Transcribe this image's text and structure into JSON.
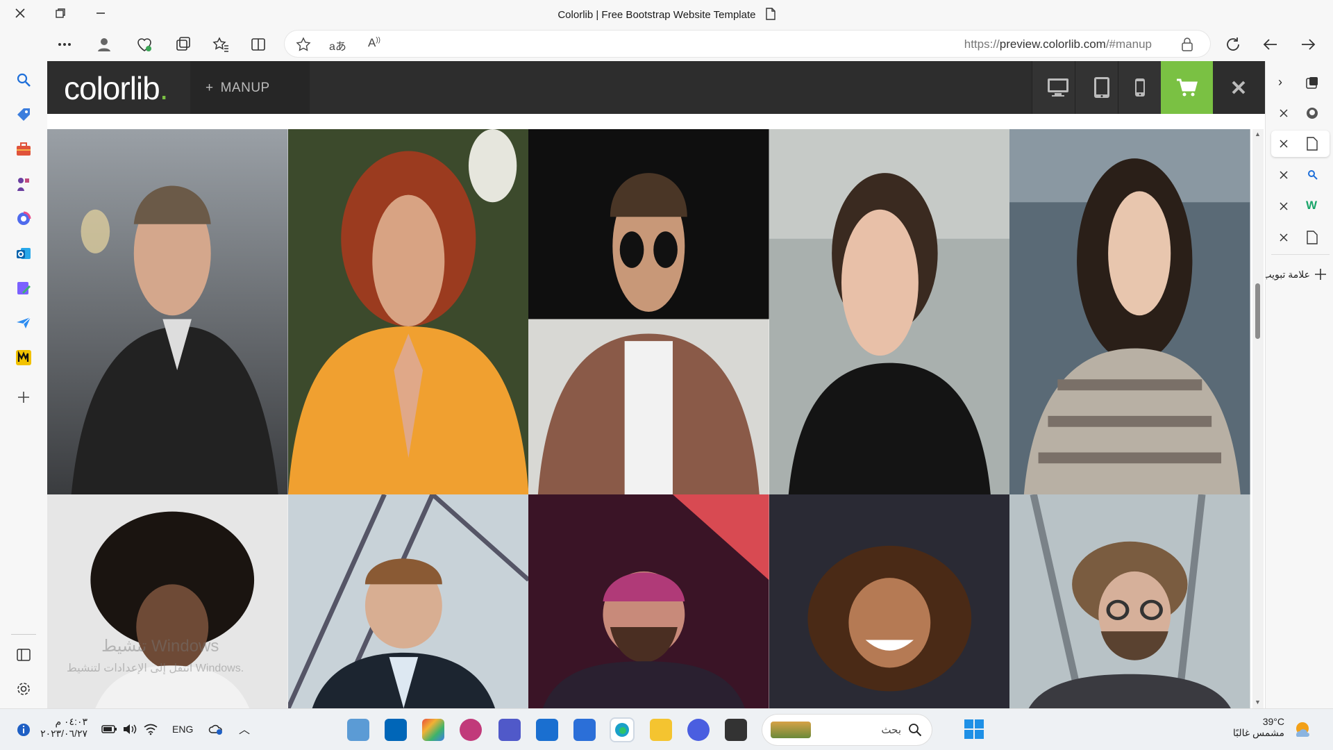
{
  "window": {
    "title": "Colorlib | Free Bootstrap Website Template"
  },
  "address_bar": {
    "url_prefix": "https://",
    "url_host": "preview.colorlib.com",
    "url_path": "/#manup"
  },
  "preview_bar": {
    "logo_text": "colorlib",
    "logo_dot": ".",
    "theme_button_label": "MANUP",
    "theme_button_icon": "plus-icon",
    "device_buttons": [
      "desktop-icon",
      "tablet-icon",
      "mobile-icon"
    ],
    "cart_icon": "cart-icon",
    "close_icon": "close-icon",
    "accent_color": "#7ac143"
  },
  "photo_grid": {
    "rows": [
      [
        "portrait-man-black-jacket",
        "portrait-woman-red-hair-orange-top",
        "portrait-man-sunglasses-brown-shirt",
        "portrait-woman-dark-top",
        "portrait-woman-striped-top"
      ],
      [
        "portrait-woman-curly-afro",
        "portrait-man-suit",
        "portrait-man-beard-stage",
        "portrait-woman-smiling-curls",
        "portrait-man-glasses-long-hair"
      ]
    ]
  },
  "watermark": {
    "line1": "تنشيط Windows",
    "line2": "انتقل إلى الإعدادات لتنشيط Windows."
  },
  "vertical_tabs": {
    "items": [
      "tab-workspaces",
      "tab-github",
      "tab-page-active",
      "tab-search",
      "tab-w",
      "tab-page"
    ],
    "new_tab_label": "علامة تبويب جديدة"
  },
  "taskbar": {
    "weather_temp": "39°C",
    "weather_desc": "مشمس غالبًا",
    "search_placeholder": "بحث",
    "language": "ENG",
    "time": "٠٤:٠٣ م",
    "date": "٢٠٢٣/٠٦/٢٧"
  }
}
